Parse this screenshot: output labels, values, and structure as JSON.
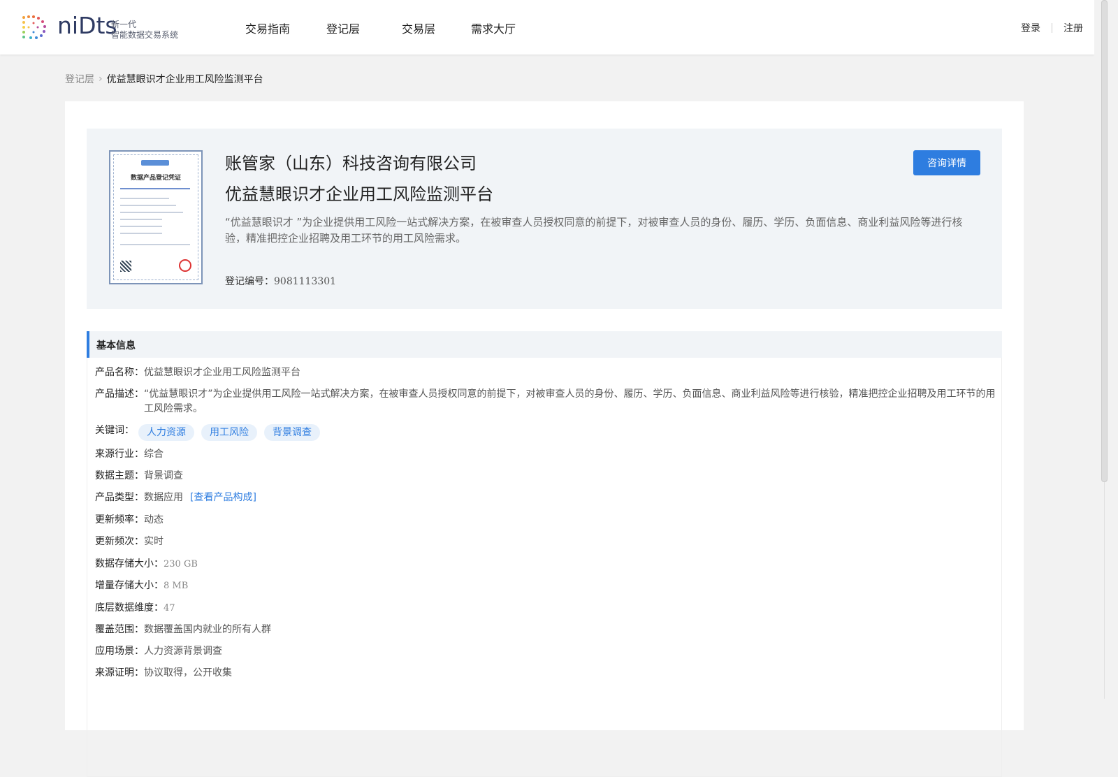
{
  "header": {
    "logo_word": "niDts",
    "logo_sub_line1": "新一代",
    "logo_sub_line2": "智能数据交易系统",
    "nav": [
      "交易指南",
      "登记层",
      "交易层",
      "需求大厅"
    ],
    "login": "登录",
    "register": "注册"
  },
  "breadcrumb": {
    "parent": "登记层",
    "current": "优益慧眼识才企业用工风险监测平台"
  },
  "hero": {
    "cert_title": "数据产品登记凭证",
    "company": "账管家（山东）科技咨询有限公司",
    "product": "优益慧眼识才企业用工风险监测平台",
    "description": "“优益慧眼识才 ”为企业提供用工风险一站式解决方案，在被审查人员授权同意的前提下，对被审查人员的身份、履历、学历、负面信息、商业利益风险等进行核验，精准把控企业招聘及用工环节的用工风险需求。",
    "reg_label": "登记编号：",
    "reg_number": "9081113301",
    "consult_button": "咨询详情"
  },
  "basic_info": {
    "title": "基本信息",
    "product_name_label": "产品名称：",
    "product_name": "优益慧眼识才企业用工风险监测平台",
    "product_desc_label": "产品描述：",
    "product_desc": "“优益慧眼识才”为企业提供用工风险一站式解决方案，在被审查人员授权同意的前提下，对被审查人员的身份、履历、学历、负面信息、商业利益风险等进行核验，精准把控企业招聘及用工环节的用工风险需求。",
    "keywords_label": "关键词：",
    "keywords": [
      "人力资源",
      "用工风险",
      "背景调查"
    ],
    "industry_label": "来源行业：",
    "industry": "综合",
    "theme_label": "数据主题：",
    "theme": "背景调查",
    "type_label": "产品类型：",
    "type": "数据应用",
    "type_link": "[查看产品构成]",
    "freq_label": "更新频率：",
    "freq": "动态",
    "freq_times_label": "更新频次：",
    "freq_times": "实时",
    "storage_label": "数据存储大小：",
    "storage": "230 GB",
    "increment_label": "增量存储大小：",
    "increment": "8 MB",
    "dimension_label": "底层数据维度：",
    "dimension": "47",
    "coverage_label": "覆盖范围：",
    "coverage": "数据覆盖国内就业的所有人群",
    "scenario_label": "应用场景：",
    "scenario": "人力资源背景调查",
    "source_label": "来源证明：",
    "source": "协议取得，公开收集"
  }
}
